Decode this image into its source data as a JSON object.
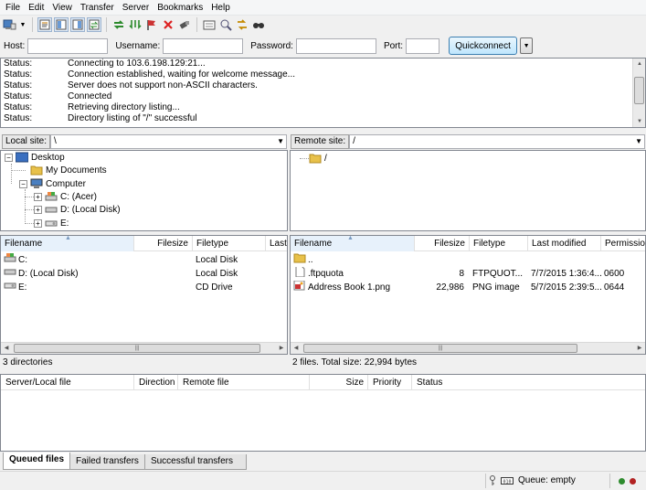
{
  "menu": [
    "File",
    "Edit",
    "View",
    "Transfer",
    "Server",
    "Bookmarks",
    "Help"
  ],
  "toolbar_icons": [
    "site-manager-icon",
    "dropdown-icon",
    "toggle-log-icon",
    "toggle-local-tree-icon",
    "toggle-remote-tree-icon",
    "toggle-queue-icon",
    "refresh-icon",
    "process-queue-icon",
    "cancel-icon",
    "disconnect-icon",
    "reconnect-icon",
    "directory-comparison-icon",
    "filter-icon",
    "sync-browse-icon",
    "search-icon"
  ],
  "quickconnect": {
    "host_label": "Host:",
    "username_label": "Username:",
    "password_label": "Password:",
    "port_label": "Port:",
    "button": "Quickconnect",
    "host": "",
    "username": "",
    "password": "",
    "port": ""
  },
  "log": [
    {
      "key": "Status:",
      "msg": "Connecting to 103.6.198.129:21..."
    },
    {
      "key": "Status:",
      "msg": "Connection established, waiting for welcome message..."
    },
    {
      "key": "Status:",
      "msg": "Server does not support non-ASCII characters."
    },
    {
      "key": "Status:",
      "msg": "Connected"
    },
    {
      "key": "Status:",
      "msg": "Retrieving directory listing..."
    },
    {
      "key": "Status:",
      "msg": "Directory listing of \"/\" successful"
    }
  ],
  "local": {
    "site_label": "Local site:",
    "path": "\\",
    "tree": {
      "desktop": "Desktop",
      "my_documents": "My Documents",
      "computer": "Computer",
      "c": "C: (Acer)",
      "d": "D: (Local Disk)",
      "e": "E:"
    },
    "columns": [
      "Filename",
      "Filesize",
      "Filetype",
      "Last"
    ],
    "files": [
      {
        "name": "C:",
        "size": "",
        "type": "Local Disk"
      },
      {
        "name": "D: (Local Disk)",
        "size": "",
        "type": "Local Disk"
      },
      {
        "name": "E:",
        "size": "",
        "type": "CD Drive"
      }
    ],
    "status": "3 directories"
  },
  "remote": {
    "site_label": "Remote site:",
    "path": "/",
    "tree_root": "/",
    "columns": [
      "Filename",
      "Filesize",
      "Filetype",
      "Last modified",
      "Permission"
    ],
    "files": [
      {
        "name": "..",
        "size": "",
        "type": "",
        "modified": "",
        "perm": ""
      },
      {
        "name": ".ftpquota",
        "size": "8",
        "type": "FTPQUOT...",
        "modified": "7/7/2015 1:36:4...",
        "perm": "0600"
      },
      {
        "name": "Address Book 1.png",
        "size": "22,986",
        "type": "PNG image",
        "modified": "5/7/2015 2:39:5...",
        "perm": "0644"
      }
    ],
    "status": "2 files. Total size: 22,994 bytes"
  },
  "queue": {
    "columns": [
      "Server/Local file",
      "Direction",
      "Remote file",
      "Size",
      "Priority",
      "Status"
    ]
  },
  "tabs": [
    "Queued files",
    "Failed transfers",
    "Successful transfers"
  ],
  "statusbar": {
    "queue": "Queue: empty"
  },
  "colors": {
    "accent": "#3c7fb1",
    "folder": "#e8c14a",
    "led_green": "#2e8b2e",
    "led_red": "#b22222"
  }
}
